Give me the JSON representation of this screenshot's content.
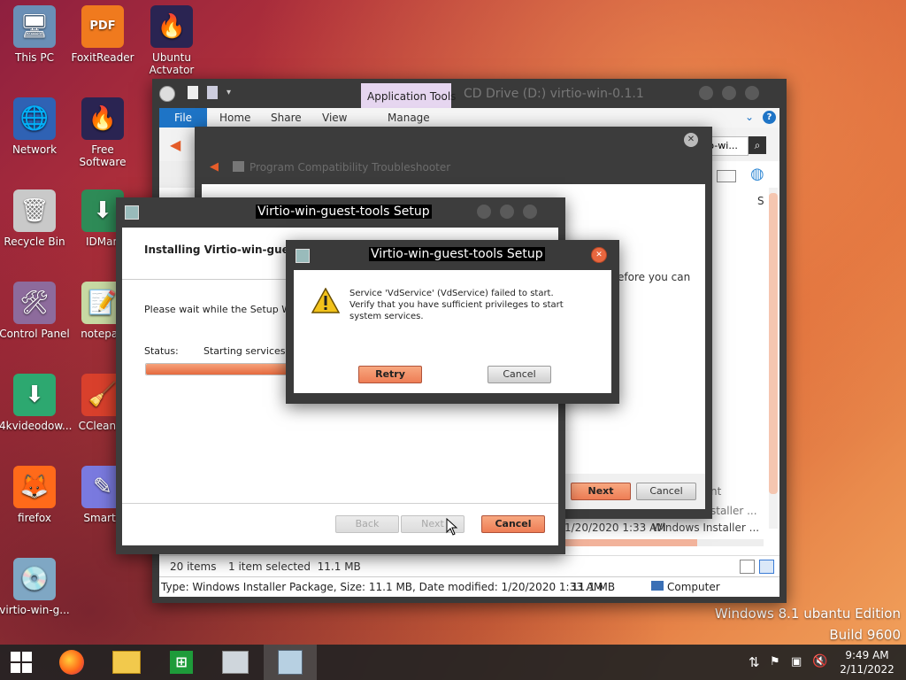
{
  "desktop": {
    "icons": [
      {
        "label": "This PC",
        "glyph": "🖥",
        "icon": "monitor-icon"
      },
      {
        "label": "FoxitReader",
        "glyph": "PDF",
        "icon": "foxit-pdf-icon"
      },
      {
        "label": "Ubuntu\nActvator",
        "glyph": "🔥",
        "icon": "firefox-doc-icon"
      },
      {
        "label": "Network",
        "glyph": "🌐",
        "icon": "network-globe-icon"
      },
      {
        "label": "Free Software",
        "glyph": "🔥",
        "icon": "firefox-doc-icon"
      },
      {
        "label": "Recycle Bin",
        "glyph": "🗑",
        "icon": "recycle-bin-icon"
      },
      {
        "label": "IDMan",
        "glyph": "⬇",
        "icon": "idm-icon"
      },
      {
        "label": "Control Panel",
        "glyph": "🛠",
        "icon": "control-panel-icon"
      },
      {
        "label": "notepad",
        "glyph": "📝",
        "icon": "notepad-icon"
      },
      {
        "label": "4kvideodow...",
        "glyph": "⬇",
        "icon": "4k-downloader-icon"
      },
      {
        "label": "CCleaner",
        "glyph": "🧹",
        "icon": "ccleaner-icon"
      },
      {
        "label": "firefox",
        "glyph": "🦊",
        "icon": "firefox-icon"
      },
      {
        "label": "SmartF",
        "glyph": "✎",
        "icon": "smartf-icon"
      },
      {
        "label": "virtio-win-g...",
        "glyph": "💿",
        "icon": "installer-icon"
      }
    ],
    "watermark_line1": "Windows 8.1 ubantu Edition",
    "watermark_line2": "Build 9600"
  },
  "explorer": {
    "title": "CD Drive (D:) virtio-win-0.1.1",
    "context_tab": "Application Tools",
    "context_tab_sub": "Manage",
    "ribbon_tabs": [
      "File",
      "Home",
      "Share",
      "View"
    ],
    "address_partial": "tio-wi...",
    "side_letter": "S",
    "row_date": "1/20/2020 1:33 AM",
    "row_type": "Windows Installer ...",
    "row2_type": "nt",
    "row3_type": "staller ...",
    "items_count": "20 items",
    "selected": "1 item selected  11.1 MB",
    "status_details": "Type: Windows Installer Package, Size: 11.1 MB, Date modified: 1/20/2020 1:33 AM",
    "status_size": "11.1 MB",
    "status_location": "Computer"
  },
  "troubleshooter": {
    "title": "Program Compatibility Troubleshooter",
    "body_fragment": "efore you can",
    "next_label": "Next",
    "cancel_label": "Cancel"
  },
  "setup": {
    "title": "Virtio-win-guest-tools Setup",
    "heading": "Installing Virtio-win-guest-tools",
    "wait_text": "Please wait while the Setup Wizard installs Virtio-win-guest-tools.",
    "status_label": "Status:",
    "status_value": "Starting services",
    "progress": 0.62,
    "back_label": "Back",
    "next_label": "Next",
    "cancel_label": "Cancel"
  },
  "error_dialog": {
    "title": "Virtio-win-guest-tools Setup",
    "message": "Service 'VdService' (VdService) failed to start.  Verify that you have sufficient privileges to start system services.",
    "retry_label": "Retry",
    "cancel_label": "Cancel"
  },
  "taskbar": {
    "time": "9:49 AM",
    "date": "2/11/2022"
  }
}
